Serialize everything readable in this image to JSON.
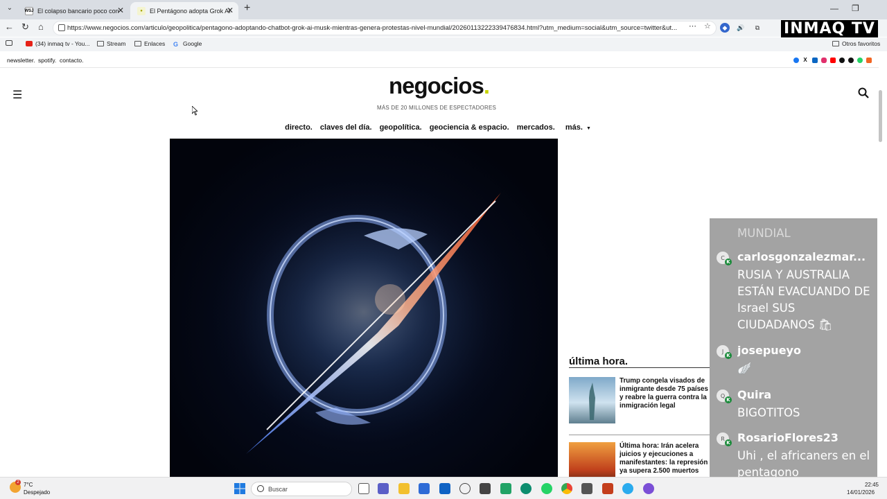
{
  "browser": {
    "tabs": [
      {
        "favicon": "WSJ",
        "title": "El colapso bancario poco conocido",
        "active": false
      },
      {
        "favicon": "grok-icon",
        "title": "El Pentágono adopta Grok AI de M",
        "active": true
      }
    ],
    "url": "https://www.negocios.com/articulo/geopolitica/pentagono-adoptando-chatbot-grok-ai-musk-mientras-genera-protestas-nivel-mundial/20260113222339476834.html?utm_medium=social&utm_source=twitter&ut...",
    "bookmarks": [
      {
        "icon": "youtube-icon",
        "label": "(34) inmaq tv - You..."
      },
      {
        "icon": "folder-icon",
        "label": "Stream"
      },
      {
        "icon": "folder-icon",
        "label": "Enlaces"
      },
      {
        "icon": "google-icon",
        "label": "Google"
      }
    ],
    "other_favorites": "Otros favoritos"
  },
  "overlay_logo": {
    "text": "INMAQ TV"
  },
  "site": {
    "top_links": [
      "newsletter.",
      "spotify.",
      "contacto."
    ],
    "logo": {
      "word": "negocios",
      "dot": "."
    },
    "tagline": "MÁS DE 20 MILLONES DE ESPECTADORES",
    "nav": [
      "directo.",
      "claves del día.",
      "geopolítica.",
      "geociencia & espacio.",
      "mercados.",
      "más."
    ],
    "accent_color": "#c7d400",
    "sidebar": {
      "title": "última hora.",
      "items": [
        {
          "headline": "Trump congela visados de inmigrante desde 75 países y reabre la guerra contra la inmigración legal"
        },
        {
          "headline": "Última hora: Irán acelera juicios y ejecuciones a manifestantes: la represión ya supera 2.500 muertos"
        }
      ]
    }
  },
  "chat": {
    "messages": [
      {
        "user": "",
        "text": "MUNDIAL",
        "avatar": ""
      },
      {
        "user": "carlosgonzalezmar...",
        "text": "RUSIA Y AUSTRALIA ESTÁN EVACUANDO DE Israel SUS CIUDADANOS 🛍",
        "avatar": "C"
      },
      {
        "user": "josepueyo",
        "text": "🪽",
        "avatar": "J"
      },
      {
        "user": "Quira",
        "text": "BIGOTITOS",
        "avatar": "Q"
      },
      {
        "user": "RosarioFlores23",
        "text": "Uhi , el africaners en el pentagono",
        "avatar": "R"
      }
    ]
  },
  "taskbar": {
    "weather_badge": "2",
    "weather_temp": "7°C",
    "weather_desc": "Despejado",
    "search_placeholder": "Buscar",
    "time": "22:45",
    "date": "14/01/2026"
  }
}
